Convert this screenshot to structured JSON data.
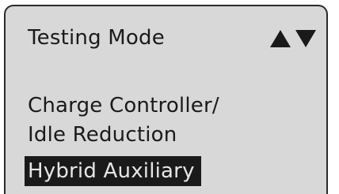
{
  "screen": {
    "title": "Testing Mode",
    "nav_icons": [
      "up-triangle-icon",
      "down-triangle-icon"
    ]
  },
  "menu": {
    "items": [
      {
        "label": "Charge Controller/"
      },
      {
        "label": "Idle Reduction"
      },
      {
        "label": "Hybrid Auxiliary",
        "selected": true
      }
    ]
  },
  "colors": {
    "screen_bg": "#d8d8d8",
    "text": "#1a1a1a",
    "highlight_bg": "#1a1a1a",
    "highlight_text": "#e6e6e6"
  }
}
